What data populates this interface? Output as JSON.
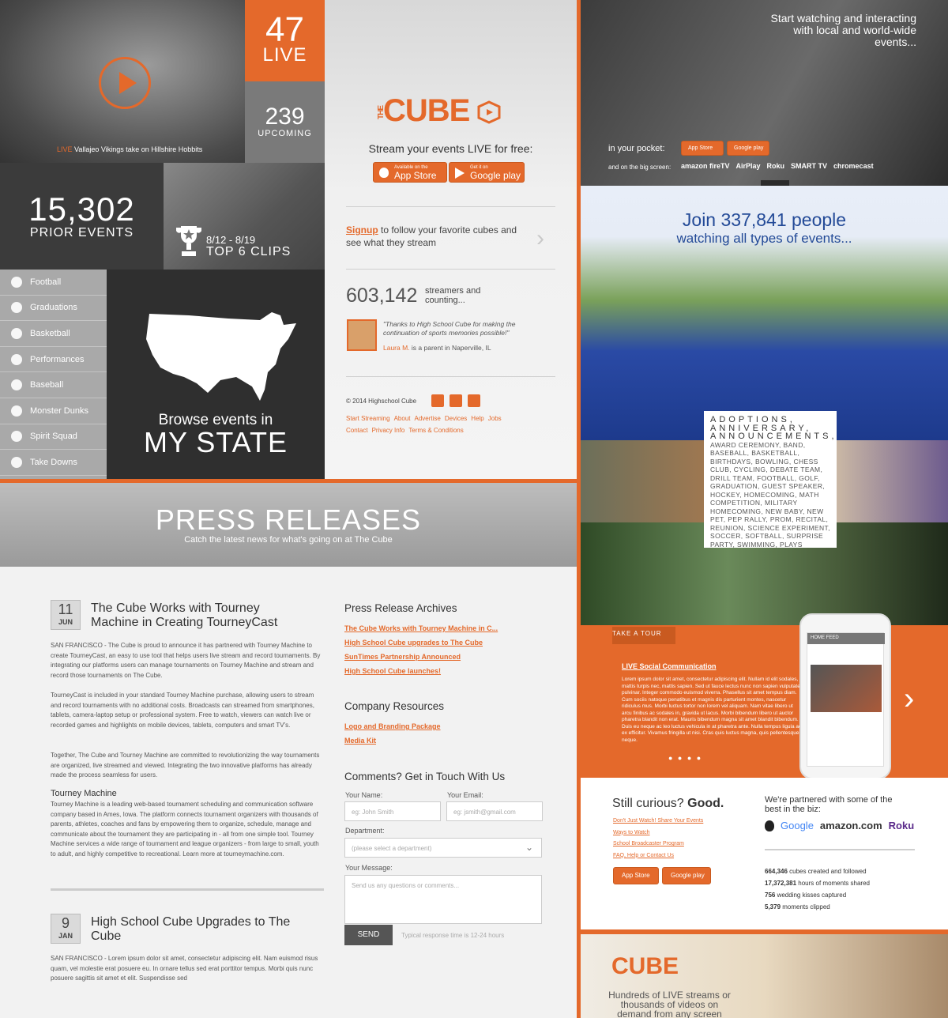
{
  "hero": {
    "live_tag": "LIVE",
    "caption": "Vallajeo Vikings take on Hillshire Hobbits"
  },
  "live": {
    "count": "47",
    "label": "LIVE"
  },
  "upcoming": {
    "count": "239",
    "label": "UPCOMING"
  },
  "prior": {
    "count": "15,302",
    "label": "PRIOR EVENTS"
  },
  "clips": {
    "dates": "8/12 - 8/19",
    "label": "TOP 6 CLIPS"
  },
  "categories": [
    "Football",
    "Graduations",
    "Basketball",
    "Performances",
    "Baseball",
    "Monster Dunks",
    "Spirit Squad",
    "Take Downs"
  ],
  "state": {
    "browse": "Browse events in",
    "my_state": "MY STATE"
  },
  "logo": {
    "the": "THE",
    "cube": "CUBE"
  },
  "tagline": "Stream your events LIVE for free:",
  "stores": {
    "apple_small": "Available on the",
    "apple": "App Store",
    "google_small": "Get it on",
    "google": "Google play"
  },
  "signup": {
    "link": "Signup",
    "text": " to follow your favorite cubes and see what they stream"
  },
  "streamers": {
    "count": "603,142",
    "label": "streamers and counting..."
  },
  "testimonial": {
    "quote": "\"Thanks to High School Cube for making the continuation of sports memories possible!\"",
    "name": "Laura M.",
    "rest": " is a parent in Naperville, IL"
  },
  "footer": {
    "copyright": "© 2014 Highschool Cube",
    "links": [
      "Start Streaming",
      "About",
      "Advertise",
      "Devices",
      "Help",
      "Jobs",
      "Contact",
      "Privacy Info",
      "Terms & Conditions"
    ]
  },
  "press": {
    "title": "PRESS RELEASES",
    "subtitle": "Catch the latest news for what's going on at The Cube"
  },
  "articles": [
    {
      "day": "11",
      "month": "JUN",
      "title": "The Cube Works with Tourney Machine in Creating TourneyCast",
      "p1": "SAN FRANCISCO - The Cube is proud to announce it has partnered with Tourney Machine to create TourneyCast, an easy to use tool that helps users live stream and record tournaments. By integrating our platforms users can manage tournaments on Tourney Machine and stream and record those tournaments on The Cube.",
      "p2": "TourneyCast is included in your standard Tourney Machine purchase, allowing users to stream and record tournaments with no additional costs. Broadcasts can streamed from smartphones, tablets, camera-laptop setup or professional system. Free to watch, viewers can watch live or recorded games and highlights on mobile devices, tablets, computers and smart TV's.",
      "p3": "Together, The Cube and Tourney Machine are committed to revolutionizing the way tournaments are organized, live streamed and viewed. Integrating the two innovative platforms  has already made the process seamless for users.",
      "sub": "Tourney Machine",
      "p4": "Tourney Machine is a leading web-based tournament scheduling and communication software company based in Ames, Iowa. The platform connects tournament organizers with thousands of parents, athletes, coaches and fans by empowering them to organize, schedule, manage and communicate about the tournament they are participating in - all from one simple tool. Tourney Machine services a wide range of tournament and league organizers - from large to small, youth to adult, and highly competitive to recreational. Learn more at tourneymachine.com."
    },
    {
      "day": "9",
      "month": "JAN",
      "title": "High School Cube Upgrades to The Cube",
      "p1": "SAN FRANCISCO - Lorem ipsum dolor sit amet, consectetur adipiscing elit. Nam euismod risus quam, vel molestie erat posuere eu. In ornare tellus sed erat porttitor tempus. Morbi quis nunc posuere sagittis sit amet et elit. Suspendisse sed"
    }
  ],
  "archives": {
    "title": "Press Release Archives",
    "items": [
      "The Cube Works with Tourney Machine in C...",
      "High School Cube upgrades to The Cube",
      "SunTimes Partnership Announced",
      "High School Cube launches!"
    ]
  },
  "resources": {
    "title": "Company Resources",
    "items": [
      "Logo and Branding Package",
      "Media Kit"
    ]
  },
  "contact": {
    "title": "Comments? Get in Touch With Us",
    "name_label": "Your Name:",
    "name_ph": "eg: John Smith",
    "email_label": "Your Email:",
    "email_ph": "eg: jsmith@gmail.com",
    "dept_label": "Department:",
    "dept_ph": "(please select a department)",
    "msg_label": "Your Message:",
    "msg_ph": "Send us any questions or comments...",
    "send": "SEND",
    "resp": "Typical response time is 12-24 hours"
  },
  "watch": {
    "headline": "Start watching and interacting with local and world-wide events...",
    "pocket": "in your pocket:",
    "bigscreen": "and on the big screen:",
    "platforms": [
      "amazon fireTV",
      "AirPlay",
      "Roku",
      "SMART TV",
      "chromecast"
    ]
  },
  "join": {
    "line1": "Join 337,841 people",
    "line2": "watching all types of events..."
  },
  "cloud": {
    "big": "ADOPTIONS, ANNIVERSARY, ANNOUNCEMENTS,",
    "text": "AWARD CEREMONY, BAND, BASEBALL, BASKETBALL, BIRTHDAYS, BOWLING, CHESS CLUB, CYCLING, DEBATE TEAM, DRILL TEAM, FOOTBALL, GOLF, GRADUATION, GUEST SPEAKER, HOCKEY, HOMECOMING, MATH COMPETITION, MILITARY HOMECOMING, NEW BABY, NEW PET, PEP RALLY, PROM, RECITAL, REUNION, SCIENCE EXPERIMENT, SOCCER, SOFTBALL, SURPRISE PARTY, SWIMMING, PLAYS"
  },
  "tour": {
    "tab": "TAKE A TOUR",
    "title": "LIVE Social Communication",
    "text": "Lorem ipsum dolor sit amet, consectetur adipiscing elit. Nullam id elit sodales, mattis turpis nec, mattis sapien. Sed ut fauce lectus nunc non sapien vulputate pulvinar. Integer commodo euismod viverra. Phasellus sit amet tempus diam. Cum sociis natoque penatibus et magnis dis parturient montes, nascetur ridiculus mus. Morbi luctus tortor non lorem vel aliquam. Nam vitae libero ut arcu finibus ac sodales in, gravida ut lacus. Morbi bibendum libero ut auctor pharetra blandit non erat. Mauris bibendum magna sit amet blandit bibendum. Duis eu neque ac leo luctus vehicula in at pharetra ante. Nulla tempus ligula ac ex efficitur. Vivamus fringilla ut nisi. Cras quis luctus magna, quis pellentesque neque.",
    "feed": "HOME FEED"
  },
  "curious": {
    "title": "Still curious?",
    "good": "Good.",
    "links": [
      "Don't Just Watch! Share Your Events",
      "Ways to Watch",
      "School Broadcaster Program",
      "FAQ, Help or Contact Us"
    ]
  },
  "partners": {
    "text": "We're partnered with some of the best in the biz:",
    "brands": [
      "Google",
      "amazon.com",
      "Roku"
    ]
  },
  "stats": [
    {
      "n": "664,346",
      "t": " cubes created and followed"
    },
    {
      "n": "17,372,381",
      "t": " hours of moments shared"
    },
    {
      "n": "756",
      "t": " wedding kisses captured"
    },
    {
      "n": "5,379",
      "t": " moments clipped"
    }
  ],
  "bottom": {
    "text": "Hundreds of LIVE streams or thousands of videos on demand from any screen"
  },
  "colors": {
    "accent": "#e4692b"
  }
}
